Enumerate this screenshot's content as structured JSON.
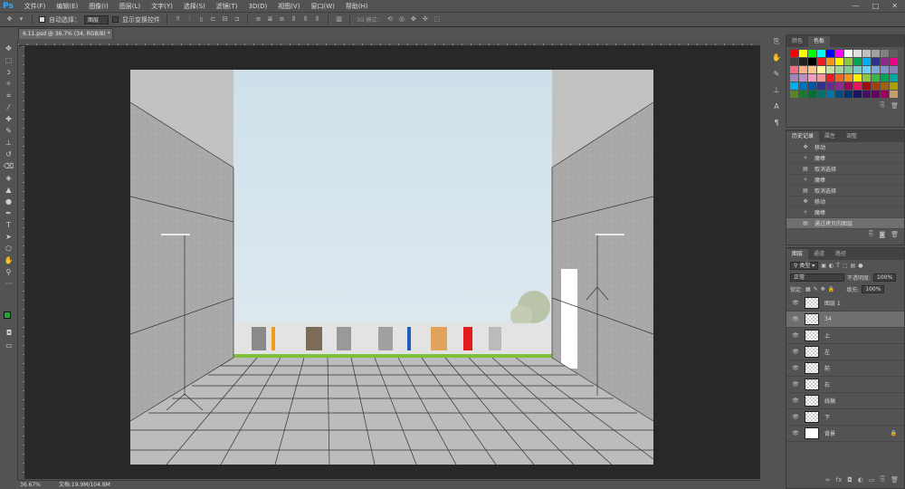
{
  "app": {
    "logo": "Ps"
  },
  "menu": [
    "文件(F)",
    "编辑(E)",
    "图像(I)",
    "图层(L)",
    "文字(Y)",
    "选择(S)",
    "滤镜(T)",
    "3D(D)",
    "视图(V)",
    "窗口(W)",
    "帮助(H)"
  ],
  "window_controls": {
    "minimize": "—",
    "maximize": "□",
    "close": "✕"
  },
  "options": {
    "auto_select_label": "自动选择：",
    "auto_select_value": "图层",
    "transform_label": "显示变换控件",
    "mode_3d_label": "3D 模式："
  },
  "document": {
    "tab_title": "6.11.psd @ 36.7% (34, RGB/8) *",
    "close": "×"
  },
  "status": {
    "zoom": "36.67%",
    "doc_size": "文档:19.9M/104.8M"
  },
  "colors": {
    "fg": "#27a33b",
    "bg": "#e21b1b"
  },
  "swatch_panel": {
    "tabs": [
      "颜色",
      "色板"
    ],
    "swatches": [
      "#ff0000",
      "#ffff00",
      "#00ff00",
      "#00ffff",
      "#0000ff",
      "#ff00ff",
      "#ffffff",
      "#e0e0e0",
      "#c0c0c0",
      "#a0a0a0",
      "#808080",
      "#606060",
      "#404040",
      "#202020",
      "#000000",
      "#ed1c24",
      "#f7941d",
      "#fff200",
      "#8dc63f",
      "#00a651",
      "#00aeef",
      "#2e3192",
      "#92278f",
      "#ec008c",
      "#f26d7d",
      "#f9ad81",
      "#fdc68a",
      "#fff799",
      "#c4df9b",
      "#a3d39c",
      "#82ca9c",
      "#7accc8",
      "#6dcff6",
      "#7da7d9",
      "#8393ca",
      "#8781bd",
      "#a186be",
      "#bd8cbf",
      "#f49ac1",
      "#f5989d",
      "#ed1c24",
      "#f26522",
      "#f7941d",
      "#fff200",
      "#8dc63f",
      "#39b54a",
      "#00a651",
      "#00a99d",
      "#00aeef",
      "#0072bc",
      "#0054a6",
      "#2e3192",
      "#662d91",
      "#92278f",
      "#9e005d",
      "#ed145b",
      "#9e0b0f",
      "#a0410d",
      "#a36209",
      "#aba000",
      "#598527",
      "#197b30",
      "#007236",
      "#00746b",
      "#0076a3",
      "#004b80",
      "#003471",
      "#1b1464",
      "#440e62",
      "#630460",
      "#9e005d",
      "#c69c6d"
    ]
  },
  "history_panel": {
    "tabs": [
      "历史记录",
      "属性",
      "调整"
    ],
    "items": [
      {
        "icon": "move",
        "label": "移动"
      },
      {
        "icon": "magic-wand",
        "label": "魔棒"
      },
      {
        "icon": "doc",
        "label": "取消选择"
      },
      {
        "icon": "magic-wand",
        "label": "魔棒"
      },
      {
        "icon": "doc",
        "label": "取消选择"
      },
      {
        "icon": "move",
        "label": "移动"
      },
      {
        "icon": "magic-wand",
        "label": "魔棒"
      },
      {
        "icon": "doc",
        "label": "通过拷贝的图层"
      }
    ]
  },
  "layers_panel": {
    "tabs": [
      "图层",
      "通道",
      "路径"
    ],
    "filter_label": "类型",
    "blend_mode": "正常",
    "opacity_label": "不透明度:",
    "opacity_value": "100%",
    "lock_label": "锁定:",
    "fill_label": "填充:",
    "fill_value": "100%",
    "layers": [
      {
        "name": "图层 1",
        "selected": false,
        "white": false
      },
      {
        "name": "34",
        "selected": true,
        "white": false
      },
      {
        "name": "上",
        "selected": false,
        "white": false
      },
      {
        "name": "左",
        "selected": false,
        "white": false
      },
      {
        "name": "前",
        "selected": false,
        "white": false
      },
      {
        "name": "右",
        "selected": false,
        "white": false
      },
      {
        "name": "线稿",
        "selected": false,
        "white": false
      },
      {
        "name": "下",
        "selected": false,
        "white": false
      },
      {
        "name": "背景",
        "selected": false,
        "white": true,
        "locked": true
      }
    ]
  }
}
